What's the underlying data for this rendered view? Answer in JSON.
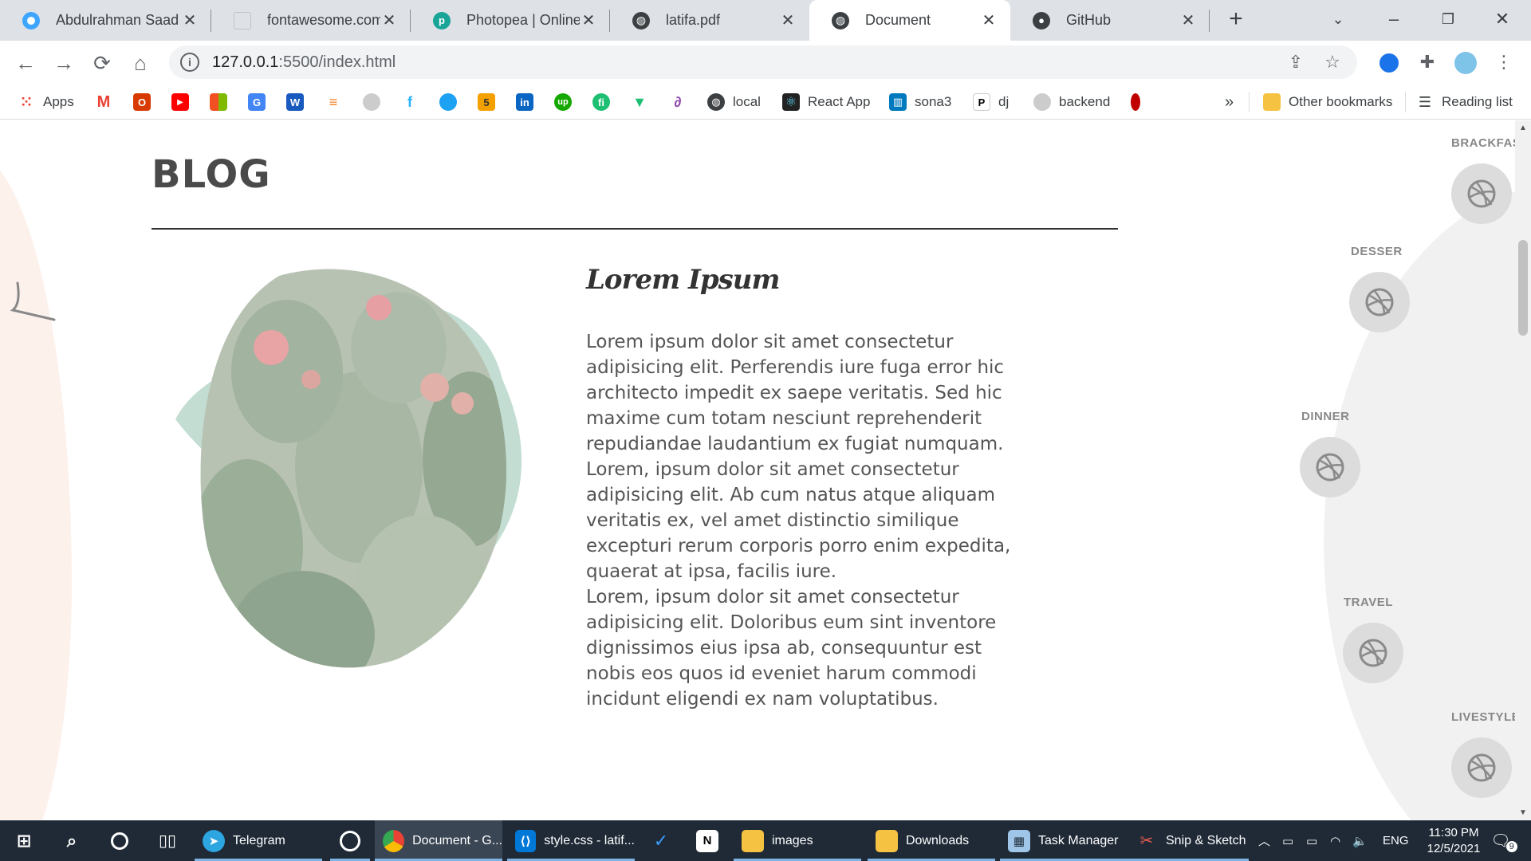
{
  "browser": {
    "tabs": [
      {
        "title": "Abdulrahman Saad |",
        "icon": "circle-icon",
        "color": "#3ea6ff",
        "active": false
      },
      {
        "title": "fontawesome.com",
        "icon": "page-icon",
        "color": "#bfc3c8",
        "active": false
      },
      {
        "title": "Photopea | Online Ph",
        "icon": "photopea-icon",
        "color": "#18a497",
        "active": false
      },
      {
        "title": "latifa.pdf",
        "icon": "globe-icon",
        "color": "#3c4043",
        "active": false
      },
      {
        "title": "Document",
        "icon": "globe-icon",
        "color": "#3c4043",
        "active": true
      },
      {
        "title": "GitHub",
        "icon": "github-icon",
        "color": "#ffffff",
        "active": false
      }
    ],
    "url_host": "127.0.0.1",
    "url_path": ":5500/index.html",
    "bookmarks": [
      {
        "label": "Apps",
        "icon": "apps-grid-icon",
        "color": "#ea4335"
      },
      {
        "label": "",
        "icon": "gmail-icon",
        "color": "#ea4335"
      },
      {
        "label": "",
        "icon": "office-icon",
        "color": "#d83b01"
      },
      {
        "label": "",
        "icon": "youtube-icon",
        "color": "#ff0000"
      },
      {
        "label": "",
        "icon": "microsoft-icon",
        "color": "#7fba00"
      },
      {
        "label": "",
        "icon": "translate-icon",
        "color": "#4285f4"
      },
      {
        "label": "",
        "icon": "word-icon",
        "color": "#185abd"
      },
      {
        "label": "",
        "icon": "stackoverflow-icon",
        "color": "#f48024"
      },
      {
        "label": "",
        "icon": "github-icon",
        "color": "#cccccc"
      },
      {
        "label": "",
        "icon": "freelancer-icon",
        "color": "#29b2fe"
      },
      {
        "label": "",
        "icon": "circle-icon",
        "color": "#1da1f2"
      },
      {
        "label": "",
        "icon": "five-icon",
        "color": "#f4a100"
      },
      {
        "label": "",
        "icon": "linkedin-icon",
        "color": "#0a66c2"
      },
      {
        "label": "",
        "icon": "upwork-icon",
        "color": "#14a800"
      },
      {
        "label": "",
        "icon": "fiverr-icon",
        "color": "#1dbf73"
      },
      {
        "label": "",
        "icon": "vuetify-icon",
        "color": "#1dbf73"
      },
      {
        "label": "",
        "icon": "swirl-icon",
        "color": "#8e44ad"
      },
      {
        "label": "local",
        "icon": "globe-icon",
        "color": "#3c4043"
      },
      {
        "label": "React App",
        "icon": "react-icon",
        "color": "#222222"
      },
      {
        "label": "sona3",
        "icon": "trello-icon",
        "color": "#0079bf"
      },
      {
        "label": "dj",
        "icon": "p-icon",
        "color": "#000000"
      },
      {
        "label": "backend",
        "icon": "github-icon",
        "color": "#cccccc"
      },
      {
        "label": "",
        "icon": "red-dot-icon",
        "color": "#c00000"
      }
    ],
    "other_bookmarks": "Other bookmarks",
    "reading_list": "Reading list",
    "overflow": "»"
  },
  "page": {
    "section_title": "BLOG",
    "post_heading": "Lorem Ipsum",
    "paragraphs": [
      "Lorem ipsum dolor sit amet consectetur adipisicing elit. Perferendis iure fuga error hic architecto impedit ex saepe veritatis. Sed hic maxime cum totam nesciunt reprehenderit repudiandae laudantium ex fugiat numquam.",
      "Lorem, ipsum dolor sit amet consectetur adipisicing elit. Ab cum natus atque aliquam veritatis ex, vel amet distinctio similique excepturi rerum corporis porro enim expedita, quaerat at ipsa, facilis iure.",
      "Lorem, ipsum dolor sit amet consectetur adipisicing elit. Doloribus eum sint inventore dignissimos eius ipsa ab, consequuntur est nobis eos quos id eveniet harum commodi incidunt eligendi ex nam voluptatibus."
    ],
    "categories": [
      "BRACKFAS",
      "DESSER",
      "DINNER",
      "TRAVEL",
      "LIVESTYLE"
    ]
  },
  "taskbar": {
    "items": [
      {
        "label": "",
        "icon": "windows-start-icon"
      },
      {
        "label": "",
        "icon": "search-icon"
      },
      {
        "label": "",
        "icon": "cortana-icon"
      },
      {
        "label": "",
        "icon": "task-view-icon"
      },
      {
        "label": "Telegram",
        "icon": "telegram-icon"
      },
      {
        "label": "",
        "icon": "obs-icon"
      },
      {
        "label": "Document - G...",
        "icon": "chrome-icon"
      },
      {
        "label": "style.css - latif...",
        "icon": "vscode-icon"
      },
      {
        "label": "",
        "icon": "todo-icon"
      },
      {
        "label": "",
        "icon": "notion-icon"
      },
      {
        "label": "images",
        "icon": "folder-icon"
      },
      {
        "label": "Downloads",
        "icon": "folder-icon"
      },
      {
        "label": "Task Manager",
        "icon": "task-manager-icon"
      },
      {
        "label": "Snip & Sketch",
        "icon": "snip-icon"
      }
    ],
    "language": "ENG",
    "time": "11:30 PM",
    "date": "12/5/2021",
    "notifications": "9"
  },
  "colors": {
    "accent": "#1a73e8",
    "text": "#555555",
    "heading": "#4a4a4a",
    "taskbar": "#1f2a36"
  }
}
